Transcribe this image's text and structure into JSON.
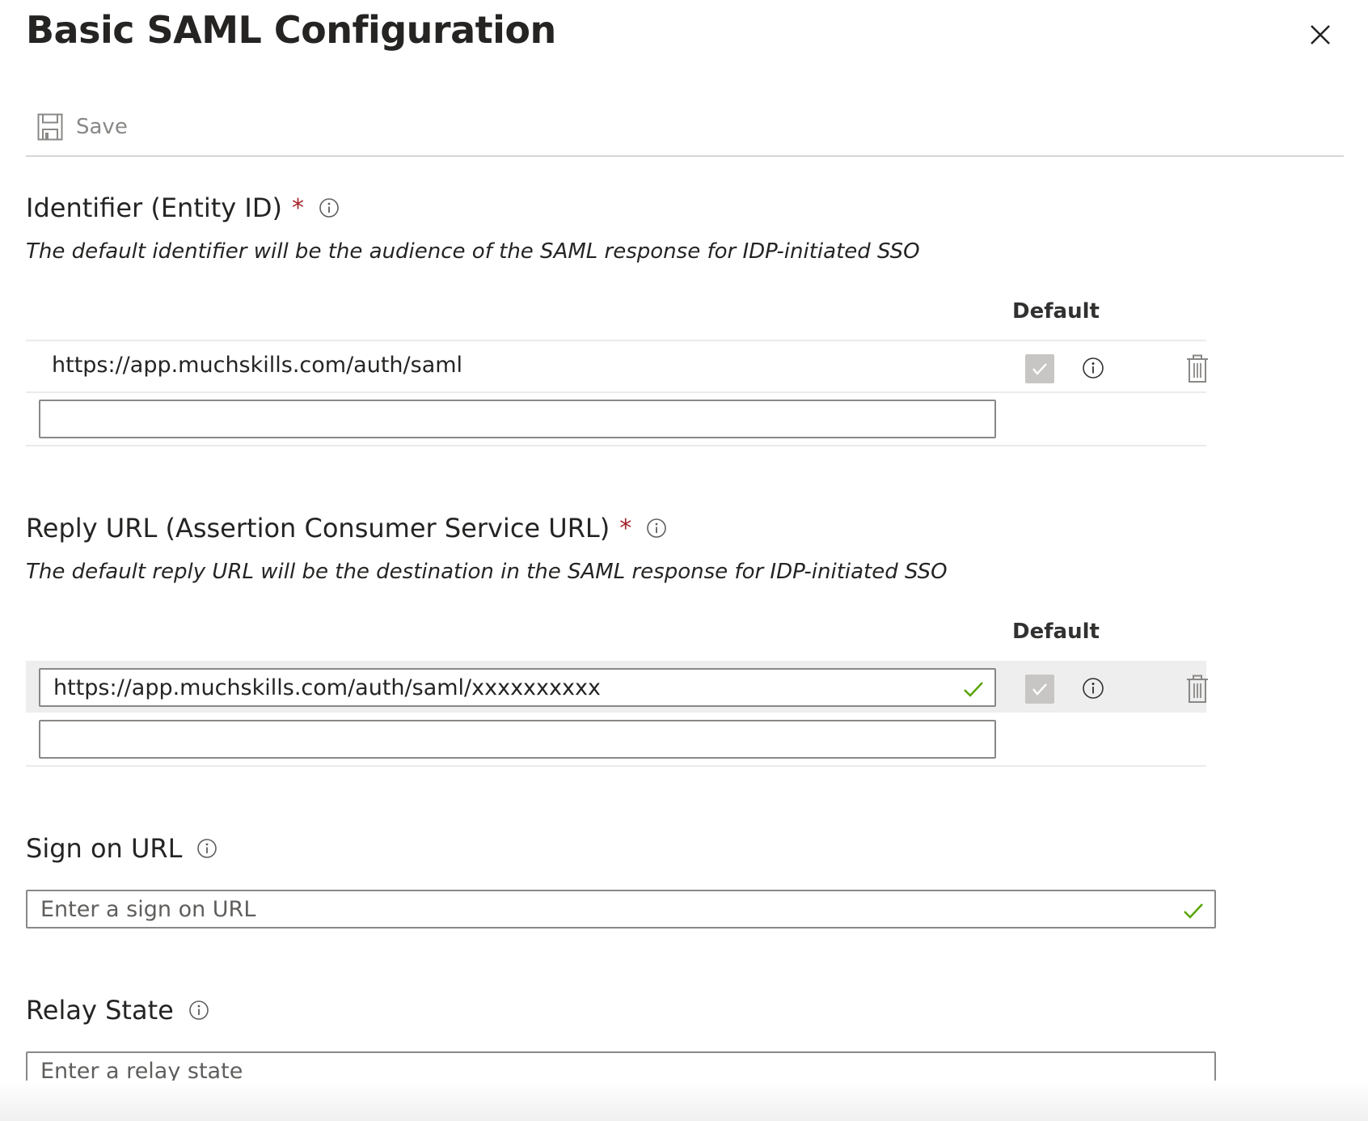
{
  "panel": {
    "title": "Basic SAML Configuration"
  },
  "toolbar": {
    "save_label": "Save"
  },
  "identifier": {
    "title": "Identifier (Entity ID)",
    "required": "*",
    "help": "The default identifier will be the audience of the SAML response for IDP-initiated SSO",
    "default_header": "Default",
    "rows": [
      {
        "value": "https://app.muchskills.com/auth/saml",
        "is_default": true
      }
    ],
    "new_value": ""
  },
  "reply_url": {
    "title": "Reply URL (Assertion Consumer Service URL)",
    "required": "*",
    "help": "The default reply URL will be the destination in the SAML response for IDP-initiated SSO",
    "default_header": "Default",
    "rows": [
      {
        "value": "https://app.muchskills.com/auth/saml/xxxxxxxxxx",
        "is_default": true
      }
    ],
    "new_value": ""
  },
  "sign_on_url": {
    "title": "Sign on URL",
    "placeholder": "Enter a sign on URL"
  },
  "relay_state": {
    "title": "Relay State",
    "placeholder": "Enter a relay state"
  },
  "colors": {
    "required": "#a4262c",
    "valid_check": "#57a300",
    "disabled_checkbox": "#c8c6c4",
    "border": "#8a8886"
  },
  "icons": {
    "close": "close-icon",
    "save": "save-icon",
    "info": "info-icon",
    "trash": "trash-icon",
    "check": "check-icon"
  }
}
